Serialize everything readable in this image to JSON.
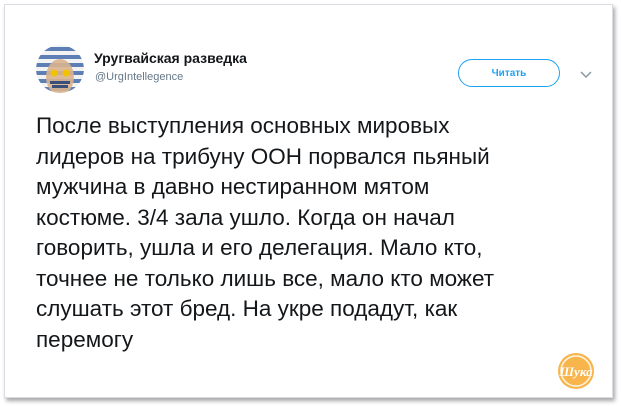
{
  "account": {
    "name": "Уругвайская разведка",
    "handle": "@UrgIntellegence",
    "avatar_icon": "uruguay-flag-face-avatar"
  },
  "actions": {
    "follow_label": "Читать",
    "more_icon": "chevron-down-icon"
  },
  "tweet": {
    "text": "После выступления основных мировых\nлидеров на трибуну ООН порвался пьяный\nмужчина в давно нестиранном мятом\nкостюме. 3/4 зала ушло. Когда он начал\nговорить, ушла и его делегация. Мало кто,\nточнее не только лишь все, мало кто может\nслушать этот бред. На укре подадут, как\nперемогу"
  },
  "watermark": {
    "text": "Шука",
    "icon": "site-watermark-logo"
  },
  "colors": {
    "accent": "#1da1f2",
    "text": "#14171a",
    "muted": "#657786",
    "watermark": "#f0a640"
  }
}
